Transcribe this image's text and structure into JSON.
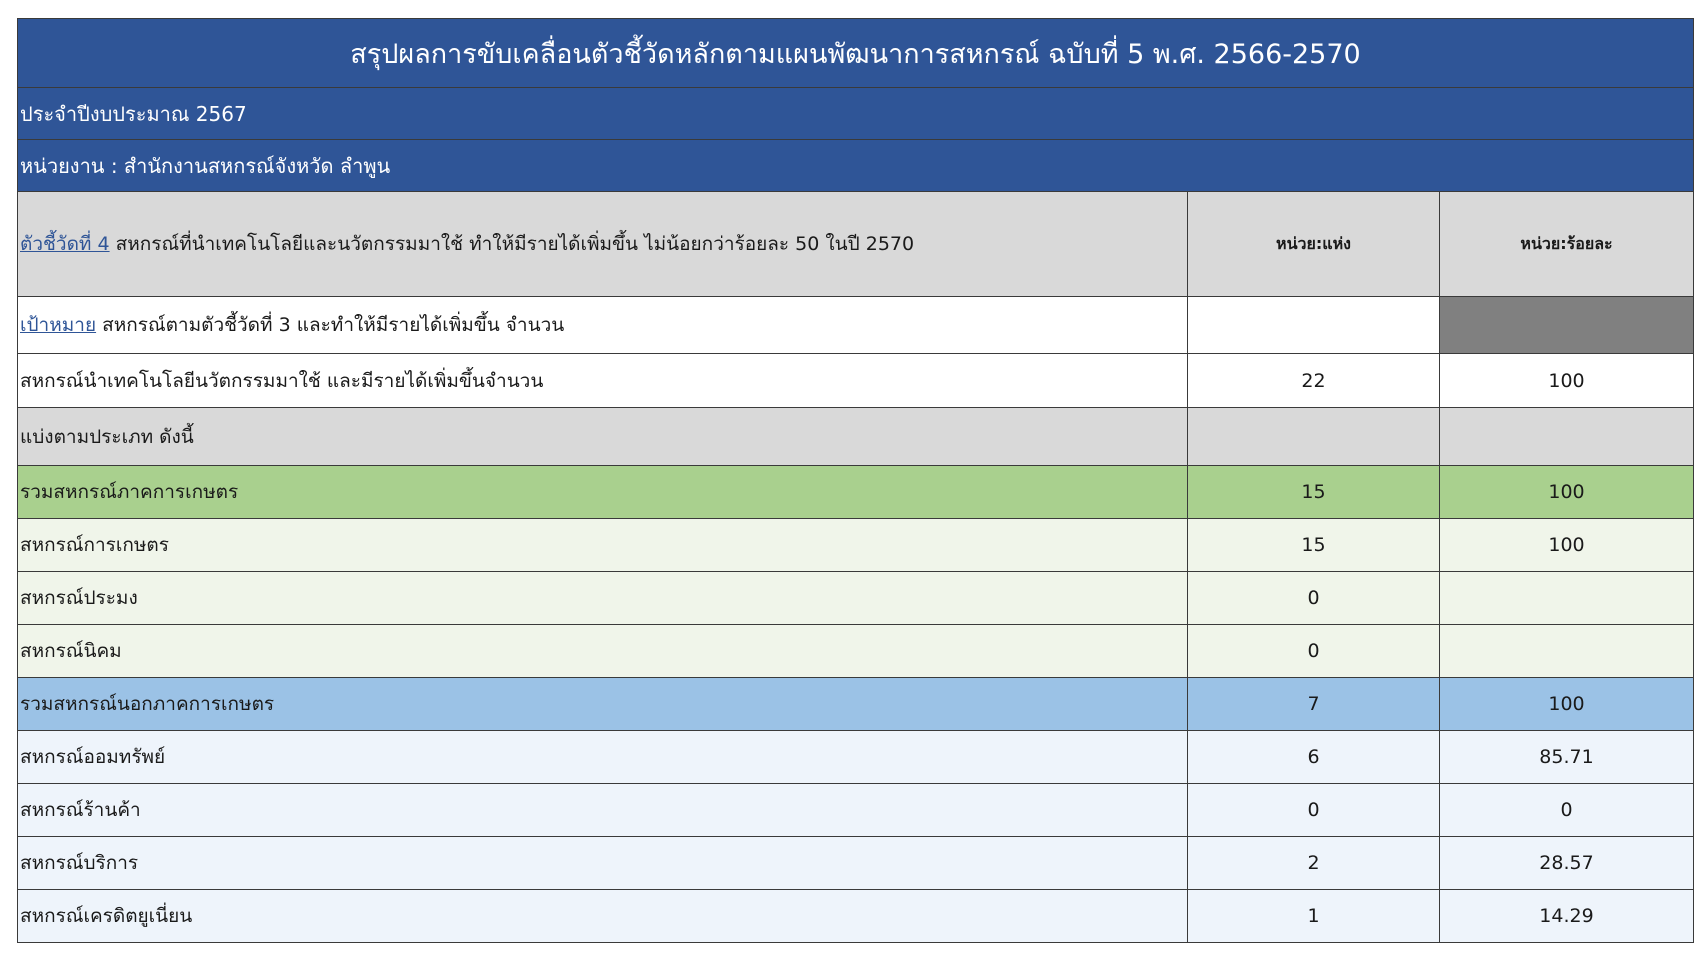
{
  "header": {
    "title": "สรุปผลการขับเคลื่อนตัวชี้วัดหลักตามแผนพัฒนาการสหกรณ์ ฉบับที่ 5 พ.ศ. 2566-2570",
    "fiscal_year": "ประจำปีงบประมาณ 2567",
    "agency": "หน่วยงาน : สำนักงานสหกรณ์จังหวัด ลำพูน"
  },
  "indicator": {
    "link_label": "ตัวชี้วัดที่ 4",
    "text": " สหกรณ์ที่นำเทคโนโลยีและนวัตกรรมมาใช้ ทำให้มีรายได้เพิ่มขึ้น ไม่น้อยกว่าร้อยละ 50 ในปี 2570",
    "unit_count": "หน่วย:แห่ง",
    "unit_percent": "หน่วย:ร้อยละ"
  },
  "target": {
    "link_label": "เป้าหมาย",
    "text": " สหกรณ์ตามตัวชี้วัดที่ 3 และทำให้มีรายได้เพิ่มขึ้น จำนวน"
  },
  "total": {
    "label": "สหกรณ์นำเทคโนโลยีนวัตกรรมมาใช้ และมีรายได้เพิ่มขึ้นจำนวน",
    "count": "22",
    "percent": "100"
  },
  "breakdown_label": "แบ่งตามประเภท ดังนี้",
  "agri": {
    "label": "รวมสหกรณ์ภาคการเกษตร",
    "count": "15",
    "percent": "100",
    "rows": [
      {
        "label": "สหกรณ์การเกษตร",
        "count": "15",
        "percent": "100"
      },
      {
        "label": "สหกรณ์ประมง",
        "count": "0",
        "percent": ""
      },
      {
        "label": "สหกรณ์นิคม",
        "count": "0",
        "percent": ""
      }
    ]
  },
  "nonagri": {
    "label": "รวมสหกรณ์นอกภาคการเกษตร",
    "count": "7",
    "percent": "100",
    "rows": [
      {
        "label": "สหกรณ์ออมทรัพย์",
        "count": "6",
        "percent": "85.71"
      },
      {
        "label": "สหกรณ์ร้านค้า",
        "count": "0",
        "percent": "0"
      },
      {
        "label": "สหกรณ์บริการ",
        "count": "2",
        "percent": "28.57"
      },
      {
        "label": "สหกรณ์เครดิตยูเนี่ยน",
        "count": "1",
        "percent": "14.29"
      }
    ]
  },
  "colors": {
    "banner": "#2f5597",
    "header_grey": "#d9d9d9",
    "agri_green": "#a9d08e",
    "nonagri_blue": "#9bc2e6",
    "target_dark": "#808080"
  }
}
